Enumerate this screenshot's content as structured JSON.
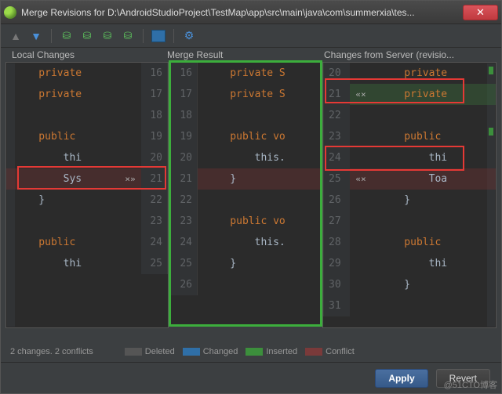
{
  "title": "Merge Revisions for D:\\AndroidStudioProject\\TestMap\\app\\src\\main\\java\\com\\summerxia\\tes...",
  "labels": {
    "local": "Local Changes",
    "merge": "Merge Result",
    "server": "Changes from Server (revisio..."
  },
  "left": [
    {
      "ln": 16,
      "cls": "",
      "code": "    private ",
      "kw": true
    },
    {
      "ln": 17,
      "cls": "",
      "code": "    private ",
      "kw": true
    },
    {
      "ln": 18,
      "cls": "",
      "code": ""
    },
    {
      "ln": 19,
      "cls": "",
      "code": "    public ",
      "kw": true
    },
    {
      "ln": 20,
      "cls": "",
      "code": "        thi"
    },
    {
      "ln": 21,
      "cls": "hl-conflict",
      "code": "        Sys",
      "mk": "×»"
    },
    {
      "ln": 22,
      "cls": "",
      "code": "    }"
    },
    {
      "ln": 23,
      "cls": "",
      "code": ""
    },
    {
      "ln": 24,
      "cls": "",
      "code": "    public ",
      "kw": true
    },
    {
      "ln": 25,
      "cls": "",
      "code": "        thi"
    }
  ],
  "mid": [
    {
      "ln": 16,
      "cls": "",
      "code": "    private S",
      "kw": true
    },
    {
      "ln": 17,
      "cls": "",
      "code": "    private S",
      "kw": true
    },
    {
      "ln": 18,
      "cls": "",
      "code": ""
    },
    {
      "ln": 19,
      "cls": "",
      "code": "    public vo",
      "kw": true
    },
    {
      "ln": 20,
      "cls": "",
      "code": "        this."
    },
    {
      "ln": 21,
      "cls": "hl-conflict",
      "code": "    }"
    },
    {
      "ln": 22,
      "cls": "",
      "code": ""
    },
    {
      "ln": 23,
      "cls": "",
      "code": "    public vo",
      "kw": true
    },
    {
      "ln": 24,
      "cls": "",
      "code": "        this."
    },
    {
      "ln": 25,
      "cls": "",
      "code": "    }"
    },
    {
      "ln": 26,
      "cls": "",
      "code": ""
    }
  ],
  "right": [
    {
      "ln": 20,
      "cls": "",
      "code": "    private",
      "kw": true
    },
    {
      "ln": 21,
      "cls": "hl-insert",
      "code": "    private",
      "kw": true,
      "mk": "«×"
    },
    {
      "ln": 22,
      "cls": "",
      "code": ""
    },
    {
      "ln": 23,
      "cls": "",
      "code": "    public",
      "kw": true
    },
    {
      "ln": 24,
      "cls": "",
      "code": "        thi"
    },
    {
      "ln": 25,
      "cls": "hl-conflict",
      "code": "        Toa",
      "mk": "«×"
    },
    {
      "ln": 26,
      "cls": "",
      "code": "    }"
    },
    {
      "ln": 27,
      "cls": "",
      "code": ""
    },
    {
      "ln": 28,
      "cls": "",
      "code": "    public",
      "kw": true
    },
    {
      "ln": 29,
      "cls": "",
      "code": "        thi"
    },
    {
      "ln": 30,
      "cls": "",
      "code": "    }"
    },
    {
      "ln": 31,
      "cls": "",
      "code": ""
    }
  ],
  "status": "2 changes. 2 conflicts",
  "legend": {
    "deleted": "Deleted",
    "changed": "Changed",
    "inserted": "Inserted",
    "conflict": "Conflict"
  },
  "buttons": {
    "apply": "Apply",
    "revert": "Revert"
  },
  "watermark": "@51CTO博客"
}
